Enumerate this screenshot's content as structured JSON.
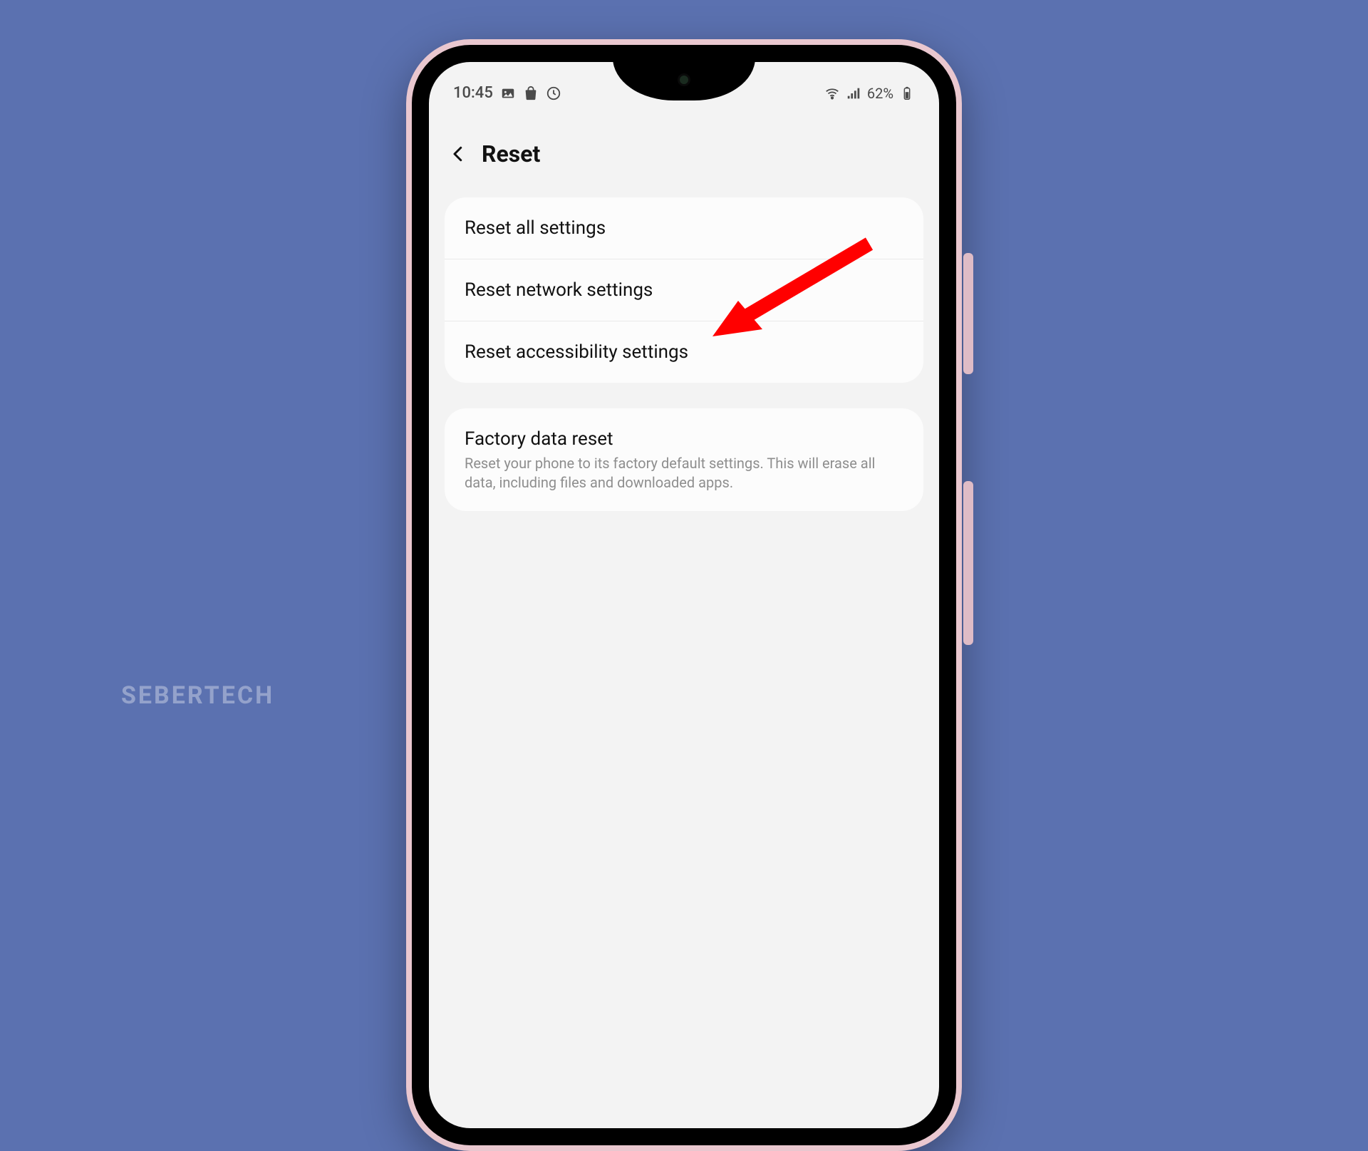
{
  "watermark": "SEBERTECH",
  "statusbar": {
    "time": "10:45",
    "battery_text": "62%"
  },
  "header": {
    "title": "Reset"
  },
  "group1": {
    "items": [
      {
        "label": "Reset all settings"
      },
      {
        "label": "Reset network settings"
      },
      {
        "label": "Reset accessibility settings"
      }
    ]
  },
  "group2": {
    "title": "Factory data reset",
    "subtitle": "Reset your phone to its factory default settings. This will erase all data, including files and downloaded apps."
  },
  "annotation": {
    "arrow_color": "#ff0000"
  }
}
